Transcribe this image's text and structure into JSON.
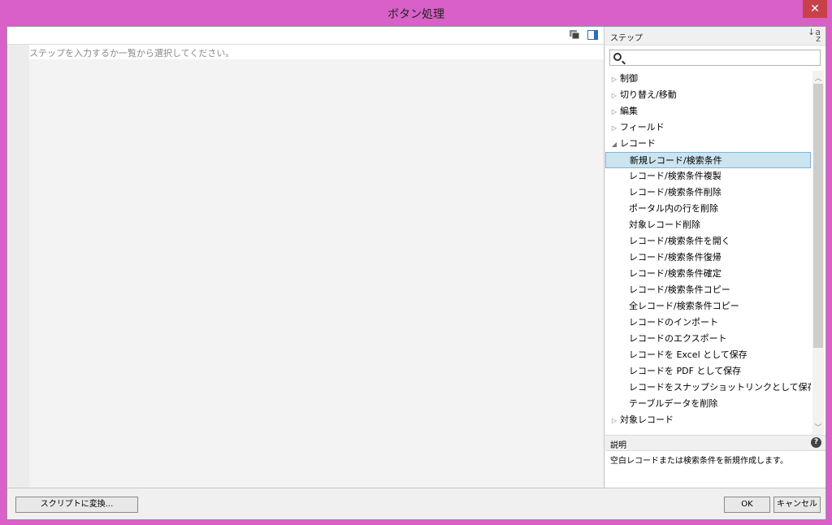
{
  "window": {
    "title": "ボタン処理",
    "close_label": "✕"
  },
  "editor": {
    "placeholder": "ステップを入力するか一覧から選択してください。"
  },
  "steps_panel": {
    "header": "ステップ",
    "sort_icon_top": "a",
    "sort_icon_bottom": "z",
    "search_placeholder": "",
    "categories": [
      {
        "label": "制御",
        "expanded": false
      },
      {
        "label": "切り替え/移動",
        "expanded": false
      },
      {
        "label": "編集",
        "expanded": false
      },
      {
        "label": "フィールド",
        "expanded": false
      },
      {
        "label": "レコード",
        "expanded": true
      },
      {
        "label": "対象レコード",
        "expanded": false
      }
    ],
    "record_steps": [
      "新規レコード/検索条件",
      "レコード/検索条件複製",
      "レコード/検索条件削除",
      "ポータル内の行を削除",
      "対象レコード削除",
      "レコード/検索条件を開く",
      "レコード/検索条件復帰",
      "レコード/検索条件確定",
      "レコード/検索条件コピー",
      "全レコード/検索条件コピー",
      "レコードのインポート",
      "レコードのエクスポート",
      "レコードを Excel として保存",
      "レコードを PDF として保存",
      "レコードをスナップショットリンクとして保存",
      "テーブルデータを削除"
    ],
    "selected_step": "新規レコード/検索条件",
    "description_header": "説明",
    "description_text": "空白レコードまたは検索条件を新規作成します。"
  },
  "footer": {
    "convert_label": "スクリプトに変換...",
    "ok_label": "OK",
    "cancel_label": "キャンセル"
  }
}
